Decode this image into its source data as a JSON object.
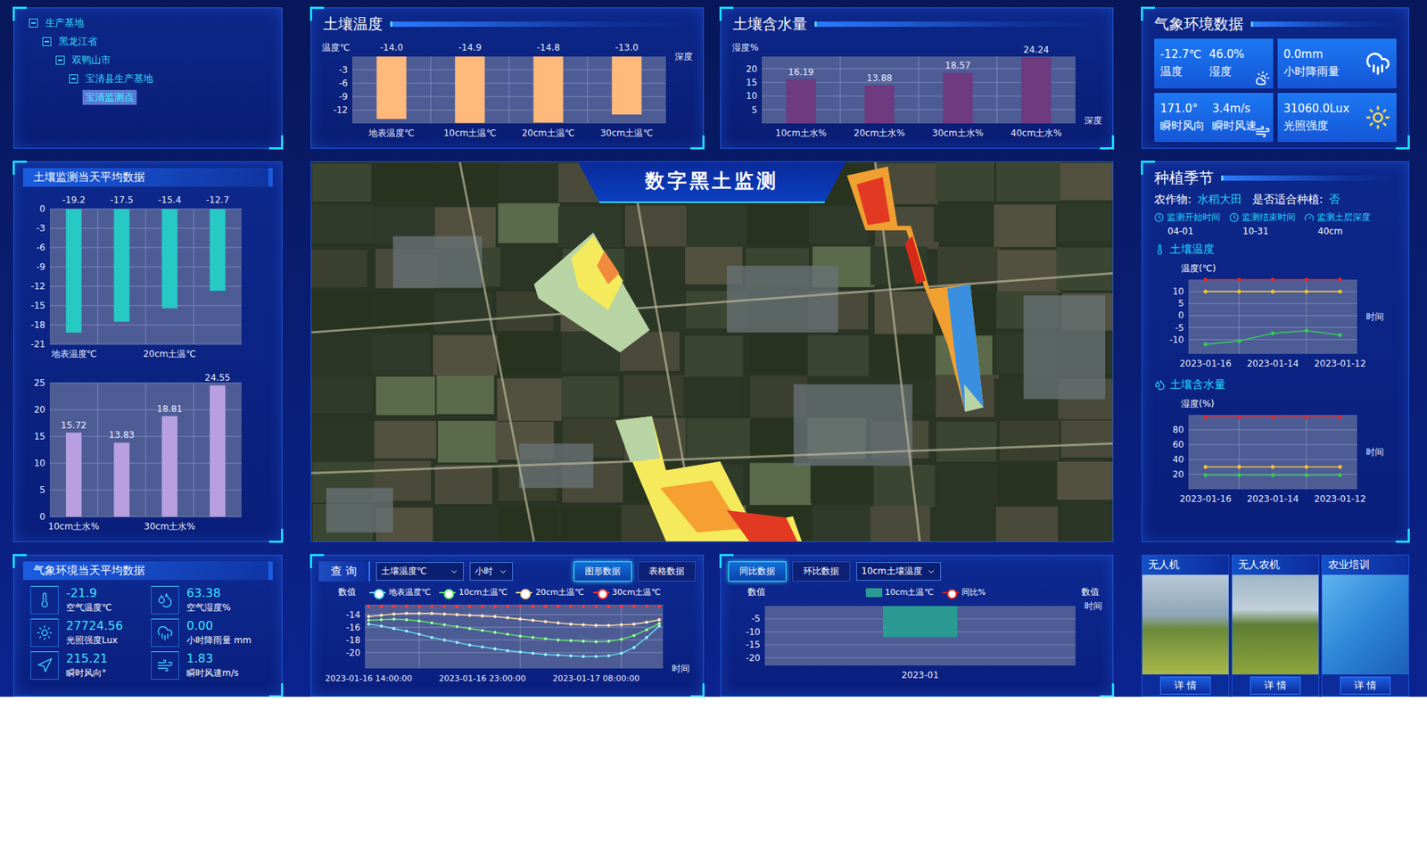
{
  "tree": {
    "items": [
      {
        "label": "生产基地",
        "depth": 0,
        "kind": "branch",
        "expanded": true,
        "selected": false
      },
      {
        "label": "黑龙江省",
        "depth": 1,
        "kind": "branch",
        "expanded": true,
        "selected": false
      },
      {
        "label": "双鸭山市",
        "depth": 2,
        "kind": "branch",
        "expanded": true,
        "selected": false
      },
      {
        "label": "宝清县生产基地",
        "depth": 3,
        "kind": "branch",
        "expanded": true,
        "selected": false
      },
      {
        "label": "宝清监测点",
        "depth": 4,
        "kind": "leaf",
        "expanded": false,
        "selected": true
      }
    ]
  },
  "soil_temperature": {
    "title": "土壤温度",
    "y_title": "温度℃",
    "x_title": "深度",
    "axis": {
      "min": -15,
      "max": 0
    },
    "ticks": [
      "-3",
      "-6",
      "-9",
      "-12"
    ],
    "bars": [
      {
        "label": "地表温度℃",
        "value": -14.0,
        "reading": "-14.0"
      },
      {
        "label": "10cm土温℃",
        "value": -14.9,
        "reading": "-14.9"
      },
      {
        "label": "20cm土温℃",
        "value": -14.8,
        "reading": "-14.8"
      },
      {
        "label": "30cm土温℃",
        "value": -13.0,
        "reading": "-13.0"
      }
    ]
  },
  "soil_moisture": {
    "title": "土壤含水量",
    "y_title": "湿度%",
    "x_title": "深度",
    "axis": {
      "min": 0,
      "max": 24.5
    },
    "ticks": [
      "20",
      "15",
      "10",
      "5"
    ],
    "bars": [
      {
        "label": "10cm土水%",
        "value": 16.19,
        "reading": "16.19"
      },
      {
        "label": "20cm土水%",
        "value": 13.88,
        "reading": "13.88"
      },
      {
        "label": "30cm土水%",
        "value": 18.57,
        "reading": "18.57"
      },
      {
        "label": "40cm土水%",
        "value": 24.24,
        "reading": "24.24"
      }
    ]
  },
  "weather": {
    "title": "气象环境数据",
    "tiles": [
      {
        "items": [
          {
            "value": "-12.7℃",
            "label": "温度"
          },
          {
            "value": "46.0%",
            "label": "湿度"
          }
        ]
      },
      {
        "items": [
          {
            "value": "0.0mm",
            "label": "小时降雨量"
          }
        ]
      },
      {
        "items": [
          {
            "value": "171.0°",
            "label": "瞬时风向"
          },
          {
            "value": "3.4m/s",
            "label": "瞬时风速"
          }
        ]
      },
      {
        "items": [
          {
            "value": "31060.0Lux",
            "label": "光照强度"
          }
        ]
      }
    ]
  },
  "daily_soil": {
    "title": "土壤监测当天平均数据",
    "temperature": {
      "axis": {
        "min": -21,
        "max": 0
      },
      "ticks": [
        "0",
        "-3",
        "-6",
        "-9",
        "-12",
        "-15",
        "-18",
        "-21"
      ],
      "bars": [
        {
          "label": "地表温度℃",
          "value": -19.2,
          "reading": "-19.2"
        },
        {
          "value": -17.5,
          "reading": "-17.5"
        },
        {
          "label": "20cm土温℃",
          "value": -15.4,
          "reading": "-15.4"
        },
        {
          "value": -12.7,
          "reading": "-12.7"
        }
      ]
    },
    "moisture": {
      "axis": {
        "min": 0,
        "max": 25
      },
      "ticks": [
        "25",
        "20",
        "15",
        "10",
        "5",
        "0"
      ],
      "bars": [
        {
          "label": "10cm土水%",
          "value": 15.72,
          "reading": "15.72"
        },
        {
          "value": 13.83,
          "reading": "13.83"
        },
        {
          "label": "30cm土水%",
          "value": 18.81,
          "reading": "18.81"
        },
        {
          "value": 24.55,
          "reading": "24.55"
        }
      ]
    }
  },
  "daily_weather": {
    "title": "气象环境当天平均数据",
    "items": [
      {
        "value": "-21.9",
        "label": "空气温度℃"
      },
      {
        "value": "63.38",
        "label": "空气湿度%"
      },
      {
        "value": "27724.56",
        "label": "光照强度Lux"
      },
      {
        "value": "0.00",
        "label": "小时降雨量 mm"
      },
      {
        "value": "215.21",
        "label": "瞬时风向°"
      },
      {
        "value": "1.83",
        "label": "瞬时风速m/s"
      }
    ]
  },
  "map": {
    "title": "数字黑土监测"
  },
  "query": {
    "tab": "查 询",
    "selects": [
      {
        "value": "土壤温度℃"
      },
      {
        "value": "小时"
      }
    ],
    "views": [
      {
        "label": "图形数据",
        "selected": true
      },
      {
        "label": "表格数据",
        "selected": false
      }
    ],
    "chart": {
      "y_title": "数值",
      "x_title": "时间",
      "axis": {
        "min": -22.5,
        "max": -12.4
      },
      "ticks": [
        "-14",
        "-16",
        "-18",
        "-20"
      ],
      "x_labels": [
        {
          "text": "2023-01-16 14:00:00",
          "index": 0
        },
        {
          "text": "2023-01-16 23:00:00",
          "index": 9
        },
        {
          "text": "2023-01-17 08:00:00",
          "index": 18
        }
      ],
      "series": [
        {
          "name": "地表温度℃",
          "color": "#66d4f0",
          "dashed": false,
          "values": [
            -15.5,
            -15.8,
            -16.2,
            -16.6,
            -17.1,
            -17.6,
            -18.0,
            -18.4,
            -18.8,
            -19.1,
            -19.4,
            -19.7,
            -19.9,
            -20.1,
            -20.3,
            -20.4,
            -20.5,
            -20.6,
            -20.6,
            -20.5,
            -20.1,
            -19.2,
            -17.6,
            -15.8
          ]
        },
        {
          "name": "10cm土温℃",
          "color": "#5ee06a",
          "dashed": false,
          "values": [
            -14.9,
            -14.8,
            -14.7,
            -14.8,
            -15.0,
            -15.3,
            -15.6,
            -15.9,
            -16.2,
            -16.5,
            -16.8,
            -17.1,
            -17.4,
            -17.6,
            -17.8,
            -18.0,
            -18.1,
            -18.2,
            -18.3,
            -18.2,
            -17.9,
            -17.3,
            -16.4,
            -15.4
          ]
        },
        {
          "name": "20cm土温℃",
          "color": "#f8d3a0",
          "dashed": false,
          "values": [
            -14.3,
            -14.1,
            -13.9,
            -13.8,
            -13.8,
            -13.8,
            -13.9,
            -14.0,
            -14.1,
            -14.2,
            -14.3,
            -14.5,
            -14.7,
            -14.9,
            -15.1,
            -15.3,
            -15.5,
            -15.6,
            -15.7,
            -15.7,
            -15.6,
            -15.5,
            -15.2,
            -14.8
          ]
        },
        {
          "name": "30cm土温℃",
          "color": "#ff3b3b",
          "dashed": true,
          "values": [
            -12.7,
            -12.7,
            -12.7,
            -12.7,
            -12.7,
            -12.7,
            -12.7,
            -12.7,
            -12.7,
            -12.7,
            -12.7,
            -12.7,
            -12.7,
            -12.7,
            -12.7,
            -12.7,
            -12.7,
            -12.7,
            -12.7,
            -12.7,
            -12.7,
            -12.7,
            -12.7,
            -12.7
          ]
        }
      ]
    }
  },
  "compare": {
    "tabs": [
      {
        "label": "同比数据",
        "selected": true
      },
      {
        "label": "环比数据",
        "selected": false
      }
    ],
    "select": {
      "value": "10cm土壤温度"
    },
    "chart": {
      "y_title": "数值",
      "y2_title": "数值",
      "x_title": "时间",
      "axis": {
        "min": -23,
        "max": 0
      },
      "ticks": [
        "-5",
        "-10",
        "-15",
        "-20"
      ],
      "legend": [
        {
          "label": "10cm土温℃",
          "color": "#2a9a92",
          "kind": "bar"
        },
        {
          "label": "同比%",
          "color": "#e02020",
          "kind": "line"
        }
      ],
      "bars": [
        {
          "label": "2023-01",
          "value": -12
        }
      ]
    }
  },
  "planting": {
    "title": "种植季节",
    "crop_label": "农作物:",
    "crop": "水稻大田",
    "suitable_label": "是否适合种植:",
    "suitable": "否",
    "schedule": [
      {
        "label": "监测开始时间",
        "value": "04-01"
      },
      {
        "label": "监测结束时间",
        "value": "10-31"
      },
      {
        "label": "监测土层深度",
        "value": "40cm"
      }
    ],
    "charts": [
      {
        "title": "土壤温度",
        "y_title": "温度(℃)",
        "x_title": "时间",
        "axis": {
          "min": -16,
          "max": 15
        },
        "ticks": [
          "10",
          "5",
          "0",
          "-5",
          "-10"
        ],
        "x_labels": [
          {
            "text": "2023-01-16",
            "index": 0
          },
          {
            "text": "2023-01-14",
            "index": 2
          },
          {
            "text": "2023-01-12",
            "index": 4
          }
        ],
        "series": [
          {
            "color": "#e02828",
            "values": [
              15,
              15,
              15,
              15,
              15
            ]
          },
          {
            "color": "#f2c230",
            "values": [
              10,
              10,
              10,
              10,
              10
            ]
          },
          {
            "color": "#30d050",
            "values": [
              -12,
              -10.6,
              -7.4,
              -6.3,
              -8.1
            ]
          }
        ]
      },
      {
        "title": "土壤含水量",
        "y_title": "湿度(%)",
        "x_title": "时间",
        "axis": {
          "min": 0,
          "max": 100
        },
        "ticks": [
          "80",
          "60",
          "40",
          "20"
        ],
        "x_labels": [
          {
            "text": "2023-01-16",
            "index": 0
          },
          {
            "text": "2023-01-14",
            "index": 2
          },
          {
            "text": "2023-01-12",
            "index": 4
          }
        ],
        "series": [
          {
            "color": "#e02828",
            "values": [
              97,
              97,
              97,
              97,
              97
            ]
          },
          {
            "color": "#f2c230",
            "values": [
              30,
              30,
              30,
              30,
              30
            ]
          },
          {
            "color": "#30d050",
            "values": [
              19,
              19,
              19,
              19,
              19
            ]
          }
        ]
      }
    ]
  },
  "services": {
    "cards": [
      {
        "title": "无人机",
        "button": "详 情"
      },
      {
        "title": "无人农机",
        "button": "详 情"
      },
      {
        "title": "农业培训",
        "button": "详 情"
      }
    ]
  }
}
